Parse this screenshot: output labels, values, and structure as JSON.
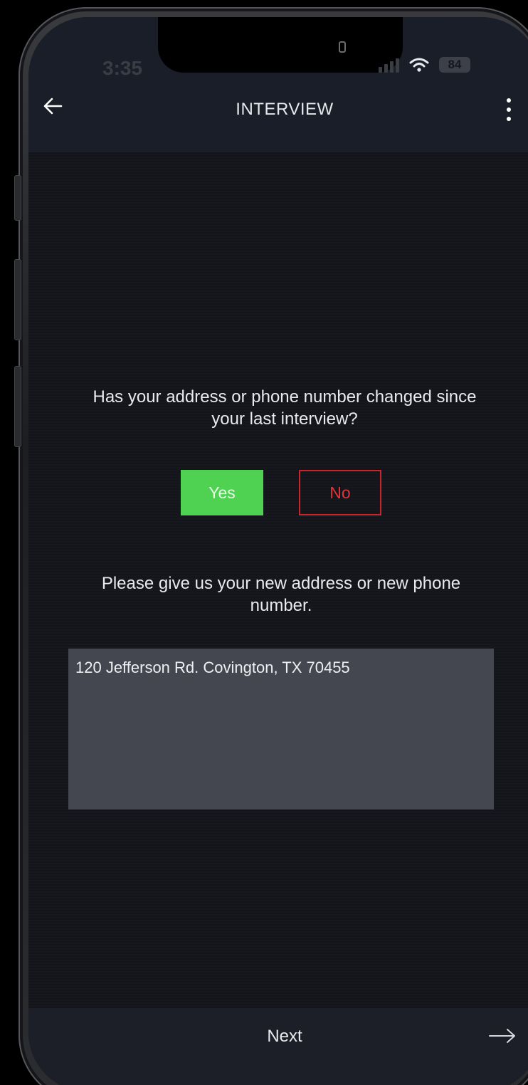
{
  "status_bar": {
    "time": "3:35",
    "battery": "84"
  },
  "header": {
    "title": "INTERVIEW",
    "back_icon": "arrow-left-icon",
    "menu_icon": "kebab-menu-icon"
  },
  "question": {
    "text": "Has your address or phone number changed since your last interview?",
    "yes_label": "Yes",
    "no_label": "No",
    "selected": "Yes"
  },
  "followup": {
    "prompt": "Please give us your new address or new phone number.",
    "answer": "120 Jefferson Rd. Covington, TX 70455"
  },
  "footer": {
    "next_label": "Next",
    "next_icon": "arrow-right-icon"
  },
  "colors": {
    "background": "#13151b",
    "header": "#1a1e28",
    "yes": "#4fd152",
    "no": "#c8262b",
    "field": "#444750"
  }
}
